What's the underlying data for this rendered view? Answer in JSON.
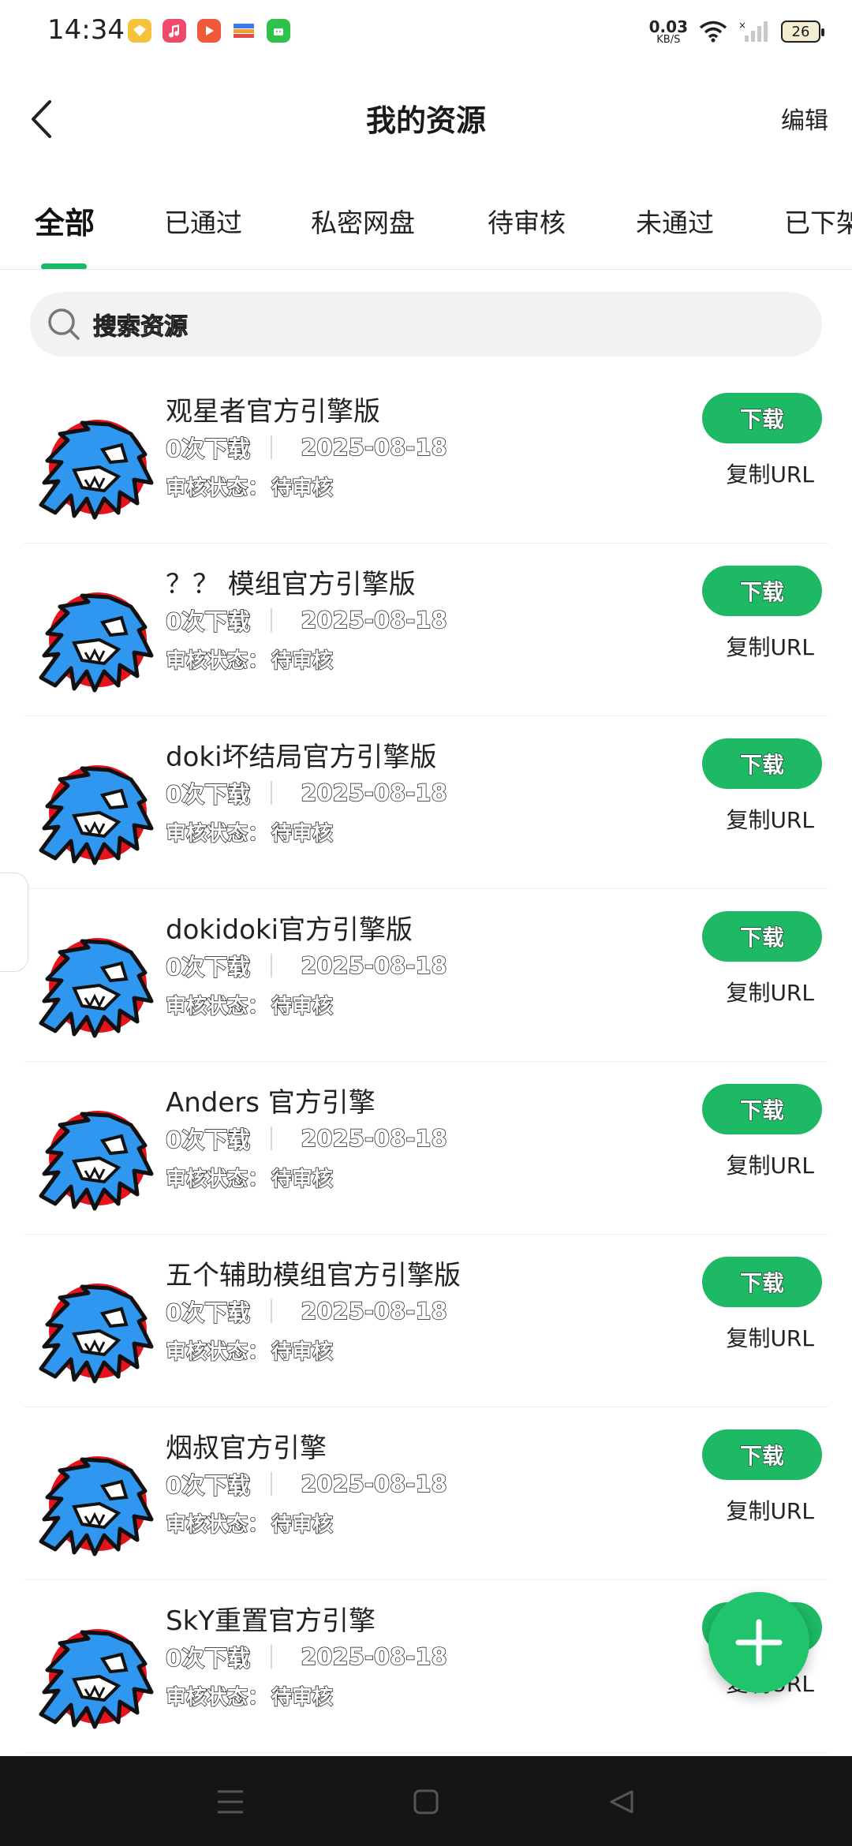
{
  "status_bar": {
    "time": "14:34",
    "net_speed_value": "0.03",
    "net_speed_unit": "KB/S",
    "battery": "26",
    "app_icons": [
      "gold-app-icon",
      "music-app-icon",
      "video-app-icon",
      "wallet-app-icon",
      "android-app-icon"
    ]
  },
  "header": {
    "title": "我的资源",
    "edit_label": "编辑"
  },
  "tabs": [
    "全部",
    "已通过",
    "私密网盘",
    "待审核",
    "未通过",
    "已下架"
  ],
  "search": {
    "placeholder": "搜索资源"
  },
  "colors": {
    "accent": "#1db964",
    "nav_bar": "#151515"
  },
  "items": [
    {
      "title": "观星者官方引擎版",
      "downloads": "0次下载",
      "date": "2025-08-18",
      "review_label": "审核状态：",
      "review_status": "待审核",
      "download_label": "下载",
      "copy_label": "复制URL"
    },
    {
      "title": "？？ 模组官方引擎版",
      "downloads": "0次下载",
      "date": "2025-08-18",
      "review_label": "审核状态：",
      "review_status": "待审核",
      "download_label": "下载",
      "copy_label": "复制URL"
    },
    {
      "title": "doki坏结局官方引擎版",
      "downloads": "0次下载",
      "date": "2025-08-18",
      "review_label": "审核状态：",
      "review_status": "待审核",
      "download_label": "下载",
      "copy_label": "复制URL"
    },
    {
      "title": "dokidoki官方引擎版",
      "downloads": "0次下载",
      "date": "2025-08-18",
      "review_label": "审核状态：",
      "review_status": "待审核",
      "download_label": "下载",
      "copy_label": "复制URL"
    },
    {
      "title": "Anders 官方引擎",
      "downloads": "0次下载",
      "date": "2025-08-18",
      "review_label": "审核状态：",
      "review_status": "待审核",
      "download_label": "下载",
      "copy_label": "复制URL"
    },
    {
      "title": "五个辅助模组官方引擎版",
      "downloads": "0次下载",
      "date": "2025-08-18",
      "review_label": "审核状态：",
      "review_status": "待审核",
      "download_label": "下载",
      "copy_label": "复制URL"
    },
    {
      "title": "烟叔官方引擎",
      "downloads": "0次下载",
      "date": "2025-08-18",
      "review_label": "审核状态：",
      "review_status": "待审核",
      "download_label": "下载",
      "copy_label": "复制URL"
    },
    {
      "title": "SkY重置官方引擎",
      "downloads": "0次下载",
      "date": "2025-08-18",
      "review_label": "审核状态：",
      "review_status": "待审核",
      "download_label": "下载",
      "copy_label": "复制URL"
    }
  ]
}
